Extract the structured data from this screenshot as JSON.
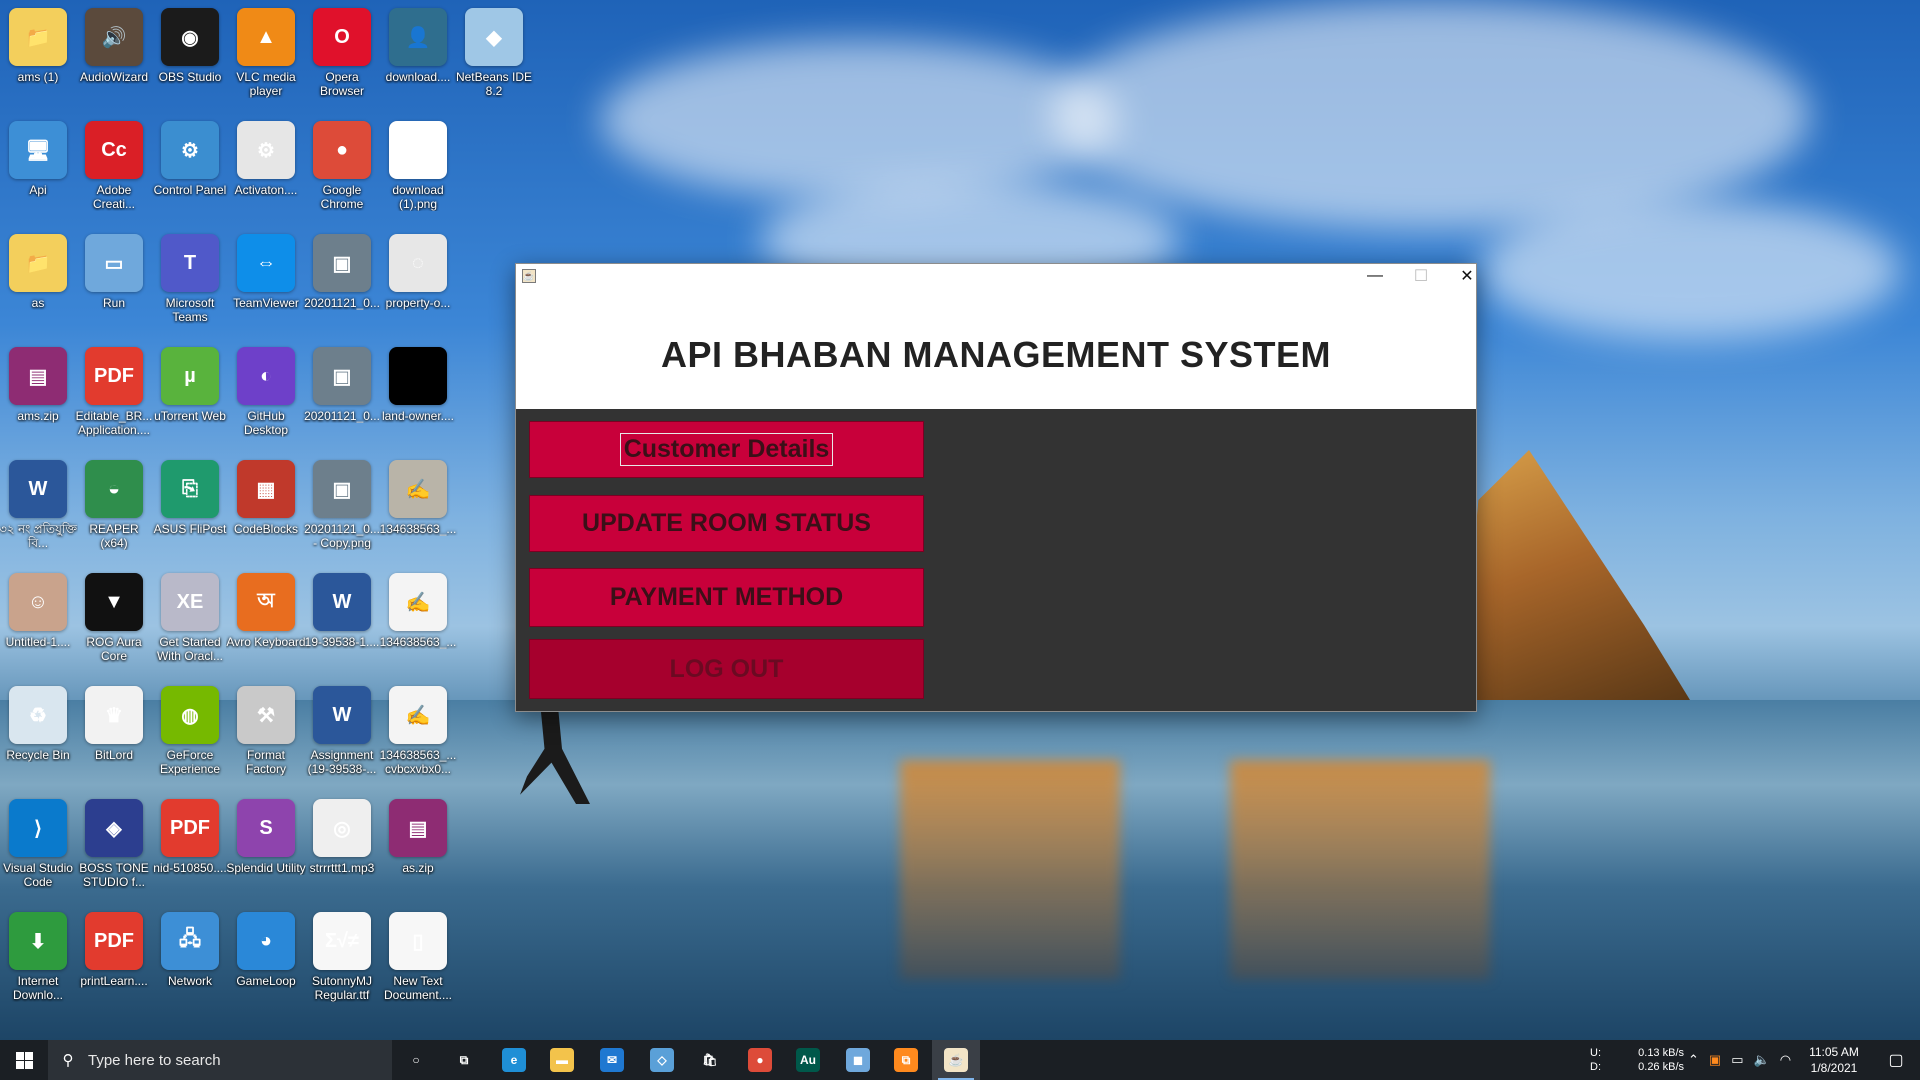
{
  "desktop": {
    "icons": [
      {
        "label": "ams (1)",
        "glyph": "📁",
        "color": "#f3cf5c"
      },
      {
        "label": "AudioWizard",
        "glyph": "🔊",
        "color": "#5b4a3c"
      },
      {
        "label": "OBS Studio",
        "glyph": "◉",
        "color": "#1b1b1b"
      },
      {
        "label": "VLC media player",
        "glyph": "▲",
        "color": "#f08a16"
      },
      {
        "label": "Opera Browser",
        "glyph": "O",
        "color": "#e0112b"
      },
      {
        "label": "download....",
        "glyph": "👤",
        "color": "#2f6e8e"
      },
      {
        "label": "NetBeans IDE 8.2",
        "glyph": "◆",
        "color": "#9fc7e6"
      },
      {
        "label": "Api",
        "glyph": "🖥",
        "color": "#3d8fd6"
      },
      {
        "label": "Adobe Creati...",
        "glyph": "Cc",
        "color": "#da1f26"
      },
      {
        "label": "Control Panel",
        "glyph": "⚙",
        "color": "#3b8ed0"
      },
      {
        "label": "Activaton....",
        "glyph": "⚙",
        "color": "#e6e6e6"
      },
      {
        "label": "Google Chrome",
        "glyph": "●",
        "color": "#dd4b39"
      },
      {
        "label": "download (1).png",
        "glyph": "⌂",
        "color": "#ffffff"
      },
      {
        "label": "as",
        "glyph": "📁",
        "color": "#f3cf5c"
      },
      {
        "label": "Run",
        "glyph": "▭",
        "color": "#6fa8dc"
      },
      {
        "label": "Microsoft Teams",
        "glyph": "T",
        "color": "#5059c9"
      },
      {
        "label": "TeamViewer",
        "glyph": "⇔",
        "color": "#0e8ee9"
      },
      {
        "label": "20201121_0...",
        "glyph": "▣",
        "color": "#6d7f8c"
      },
      {
        "label": "property-o...",
        "glyph": "◌",
        "color": "#e7e7e7"
      },
      {
        "label": "ams.zip",
        "glyph": "▤",
        "color": "#8e2c73"
      },
      {
        "label": "Editable_BR... Application....",
        "glyph": "PDF",
        "color": "#e23b2e"
      },
      {
        "label": "uTorrent Web",
        "glyph": "µ",
        "color": "#59b33d"
      },
      {
        "label": "GitHub Desktop",
        "glyph": "◐",
        "color": "#6e40c9"
      },
      {
        "label": "20201121_0...",
        "glyph": "▣",
        "color": "#6d7f8c"
      },
      {
        "label": "land-owner....",
        "glyph": "",
        "color": "#000000"
      },
      {
        "label": "৩২ নং প্রতিযুক্তি বি...",
        "glyph": "W",
        "color": "#2b579a"
      },
      {
        "label": "REAPER (x64)",
        "glyph": "◒",
        "color": "#2f8e4c"
      },
      {
        "label": "ASUS FliPost",
        "glyph": "⎘",
        "color": "#1f9a6d"
      },
      {
        "label": "CodeBlocks",
        "glyph": "▦",
        "color": "#c0392b"
      },
      {
        "label": "20201121_0... - Copy.png",
        "glyph": "▣",
        "color": "#6d7f8c"
      },
      {
        "label": "134638563_...",
        "glyph": "✍",
        "color": "#b9b4a8"
      },
      {
        "label": "Untitled-1....",
        "glyph": "☺",
        "color": "#c9a38c"
      },
      {
        "label": "ROG Aura Core",
        "glyph": "▼",
        "color": "#111111"
      },
      {
        "label": "Get Started With Oracl...",
        "glyph": "XE",
        "color": "#b9b9c9"
      },
      {
        "label": "Avro Keyboard",
        "glyph": "অ",
        "color": "#e86d1f"
      },
      {
        "label": "19-39538-1....",
        "glyph": "W",
        "color": "#2b579a"
      },
      {
        "label": "134638563_...",
        "glyph": "✍",
        "color": "#f4f4f4"
      },
      {
        "label": "Recycle Bin",
        "glyph": "♻",
        "color": "#d9e6ef"
      },
      {
        "label": "BitLord",
        "glyph": "♛",
        "color": "#f2f2f2"
      },
      {
        "label": "GeForce Experience",
        "glyph": "◍",
        "color": "#76b900"
      },
      {
        "label": "Format Factory",
        "glyph": "⚒",
        "color": "#c9c9c9"
      },
      {
        "label": "Assignment (19-39538-...",
        "glyph": "W",
        "color": "#2b579a"
      },
      {
        "label": "134638563_... cvbcxvbx0...",
        "glyph": "✍",
        "color": "#f4f4f4"
      },
      {
        "label": "Visual Studio Code",
        "glyph": "⟩",
        "color": "#0a7acc"
      },
      {
        "label": "BOSS TONE STUDIO f...",
        "glyph": "◈",
        "color": "#2c3e8f"
      },
      {
        "label": "nid-510850....",
        "glyph": "PDF",
        "color": "#e23b2e"
      },
      {
        "label": "Splendid Utility",
        "glyph": "S",
        "color": "#8e44ad"
      },
      {
        "label": "strrrttt1.mp3",
        "glyph": "◎",
        "color": "#efefef"
      },
      {
        "label": "as.zip",
        "glyph": "▤",
        "color": "#8e2c73"
      },
      {
        "label": "Internet Downlo...",
        "glyph": "⬇",
        "color": "#2e9b3e"
      },
      {
        "label": "printLearn....",
        "glyph": "PDF",
        "color": "#e23b2e"
      },
      {
        "label": "Network",
        "glyph": "🖧",
        "color": "#3d8fd6"
      },
      {
        "label": "GameLoop",
        "glyph": "◕",
        "color": "#2a88d8"
      },
      {
        "label": "SutonnyMJ Regular.ttf",
        "glyph": "Σ√≠",
        "color": "#f7f7f7"
      },
      {
        "label": "New Text Document....",
        "glyph": "▯",
        "color": "#f7f7f7"
      }
    ]
  },
  "window": {
    "title_icon": "java-icon",
    "controls": {
      "minimize": "—",
      "maximize": "☐",
      "close": "✕"
    },
    "heading": "API BHABAN MANAGEMENT SYSTEM",
    "buttons": [
      {
        "label": "Customer Details",
        "name": "customer-details-button"
      },
      {
        "label": "UPDATE ROOM STATUS",
        "name": "update-room-status-button"
      },
      {
        "label": "PAYMENT METHOD",
        "name": "payment-method-button"
      },
      {
        "label": "LOG OUT",
        "name": "log-out-button"
      }
    ],
    "button_color": "#c8003a",
    "panel_color": "#333333"
  },
  "taskbar": {
    "search_placeholder": "Type here to search",
    "apps": [
      {
        "name": "cortana",
        "glyph": "○",
        "color": "transparent"
      },
      {
        "name": "task-view",
        "glyph": "⧉",
        "color": "transparent"
      },
      {
        "name": "edge",
        "glyph": "e",
        "color": "#1f8fd6"
      },
      {
        "name": "file-explorer",
        "glyph": "▬",
        "color": "#f3c34b"
      },
      {
        "name": "mail",
        "glyph": "✉",
        "color": "#1f78d1"
      },
      {
        "name": "azure-data",
        "glyph": "◇",
        "color": "#5aa0d8"
      },
      {
        "name": "store",
        "glyph": "🛍",
        "color": "transparent"
      },
      {
        "name": "chrome",
        "glyph": "●",
        "color": "#dd4b39"
      },
      {
        "name": "audition",
        "glyph": "Au",
        "color": "#00584a"
      },
      {
        "name": "virtualbox",
        "glyph": "◼",
        "color": "#6fa8dc"
      },
      {
        "name": "sublime",
        "glyph": "⧉",
        "color": "#ff8a1e"
      },
      {
        "name": "java-app",
        "glyph": "☕",
        "color": "#f2e4c6"
      }
    ],
    "net_labels": {
      "up": "U:",
      "down": "D:"
    },
    "net_up": "0.13 kB/s",
    "net_down": "0.26 kB/s",
    "time": "11:05 AM",
    "date": "1/8/2021"
  }
}
